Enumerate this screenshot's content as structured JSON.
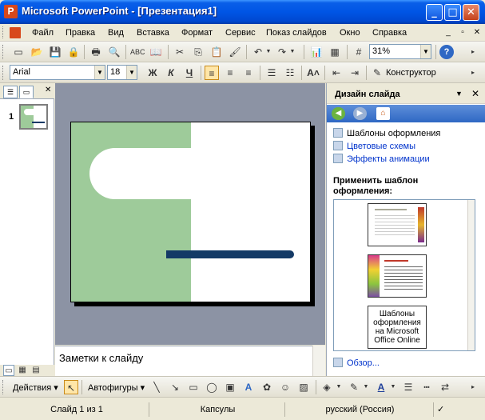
{
  "window": {
    "title": "Microsoft PowerPoint - [Презентация1]"
  },
  "menu": [
    "Файл",
    "Правка",
    "Вид",
    "Вставка",
    "Формат",
    "Сервис",
    "Показ слайдов",
    "Окно",
    "Справка"
  ],
  "toolbar_std": {
    "zoom": "31%"
  },
  "toolbar_fmt": {
    "font": "Arial",
    "size": "18",
    "bold": "Ж",
    "italic": "К",
    "underline": "Ч",
    "designer": "Конструктор"
  },
  "outline": {
    "slide_number": "1"
  },
  "notes": {
    "placeholder": "Заметки к слайду"
  },
  "taskpane": {
    "title": "Дизайн слайда",
    "links": [
      "Шаблоны оформления",
      "Цветовые схемы",
      "Эффекты анимации"
    ],
    "apply_label": "Применить шаблон оформления:",
    "online_template": "Шаблоны оформления на Microsoft Office Online",
    "browse": "Обзор..."
  },
  "drawbar": {
    "actions": "Действия",
    "autoshapes": "Автофигуры"
  },
  "status": {
    "slide": "Слайд 1 из 1",
    "design": "Капсулы",
    "language": "русский (Россия)"
  },
  "colors": {
    "title_bar": "#0055e5",
    "slide_green": "#9ecb9a",
    "slide_bar": "#143a66",
    "link": "#0033cc"
  }
}
